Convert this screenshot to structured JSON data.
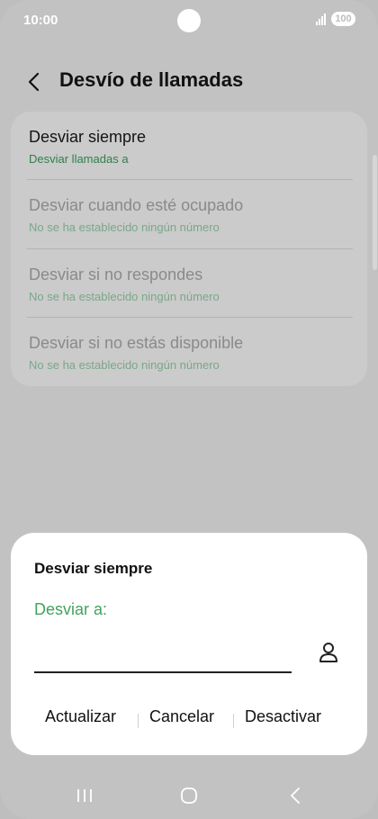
{
  "status_bar": {
    "time": "10:00",
    "battery": "100",
    "signal_icon": "signal-icon"
  },
  "header": {
    "title": "Desvío de llamadas",
    "back_icon": "chevron-left-icon"
  },
  "options": [
    {
      "title": "Desviar siempre",
      "subtitle": "Desviar llamadas a",
      "enabled": true
    },
    {
      "title": "Desviar cuando esté ocupado",
      "subtitle": "No se ha establecido ningún número",
      "enabled": false
    },
    {
      "title": "Desviar si no respondes",
      "subtitle": "No se ha establecido ningún número",
      "enabled": false
    },
    {
      "title": "Desviar si no estás disponible",
      "subtitle": "No se ha establecido ningún número",
      "enabled": false
    }
  ],
  "dialog": {
    "title": "Desviar siempre",
    "field_label": "Desviar a:",
    "input_value": "",
    "contact_icon": "person-icon",
    "actions": {
      "update": "Actualizar",
      "cancel": "Cancelar",
      "disable": "Desactivar"
    }
  },
  "nav_bar": {
    "recents_icon": "recents-icon",
    "home_icon": "home-icon",
    "back_icon": "back-icon"
  },
  "colors": {
    "accent_green": "#3fa45d",
    "overlay": "#c2c2c2",
    "dialog_bg": "#ffffff"
  }
}
